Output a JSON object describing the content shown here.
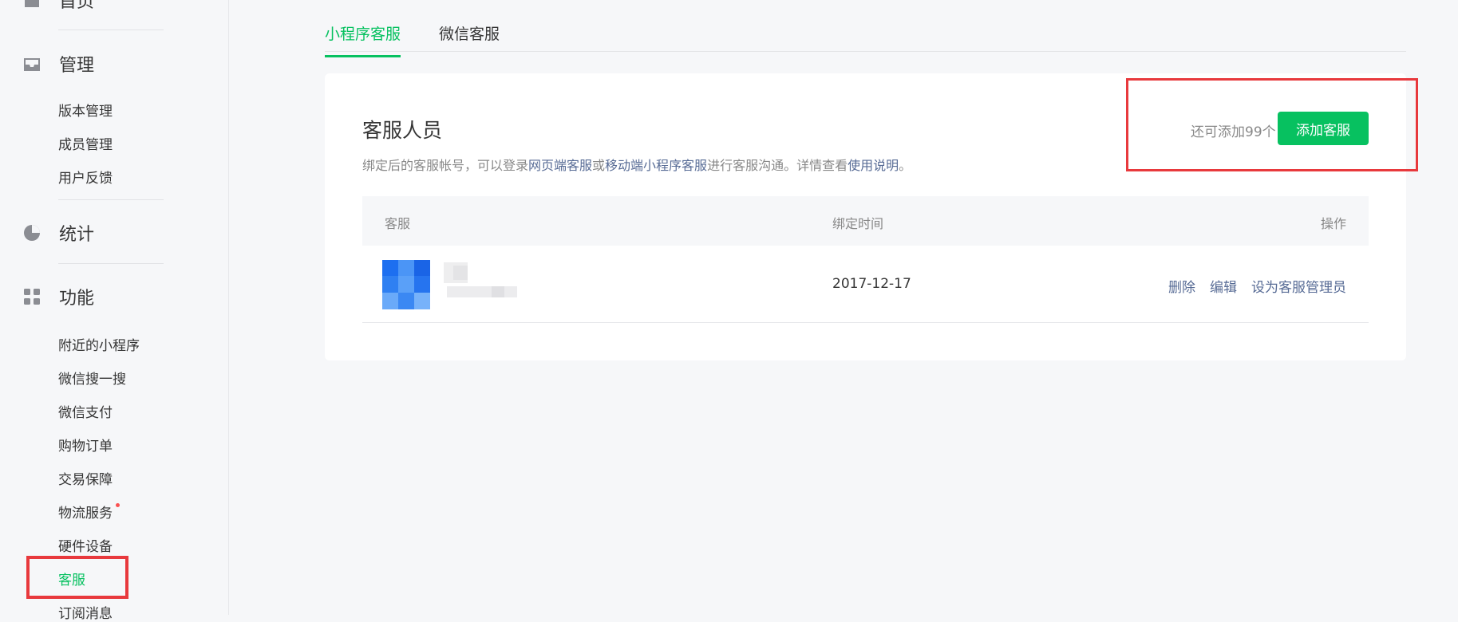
{
  "sidebar": {
    "home": {
      "label": "首页"
    },
    "manage": {
      "label": "管理",
      "items": [
        "版本管理",
        "成员管理",
        "用户反馈"
      ]
    },
    "stats": {
      "label": "统计"
    },
    "features": {
      "label": "功能",
      "items": [
        "附近的小程序",
        "微信搜一搜",
        "微信支付",
        "购物订单",
        "交易保障",
        "物流服务",
        "硬件设备",
        "客服",
        "订阅消息"
      ]
    }
  },
  "tabs": [
    "小程序客服",
    "微信客服"
  ],
  "card": {
    "title": "客服人员",
    "desc_parts": [
      "绑定后的客服帐号，可以登录",
      "网页端客服",
      "或",
      "移动端小程序客服",
      "进行客服沟通。详情查看",
      "使用说明",
      "。"
    ],
    "remaining": "还可添加99个",
    "add_button": "添加客服"
  },
  "table": {
    "headers": {
      "agent": "客服",
      "bind_time": "绑定时间",
      "ops": "操作"
    },
    "rows": [
      {
        "bind_time": "2017-12-17",
        "ops": [
          "删除",
          "编辑",
          "设为客服管理员"
        ]
      }
    ]
  },
  "colors": {
    "brand": "#07c160",
    "link": "#576b95",
    "highlight": "#e8393d"
  }
}
